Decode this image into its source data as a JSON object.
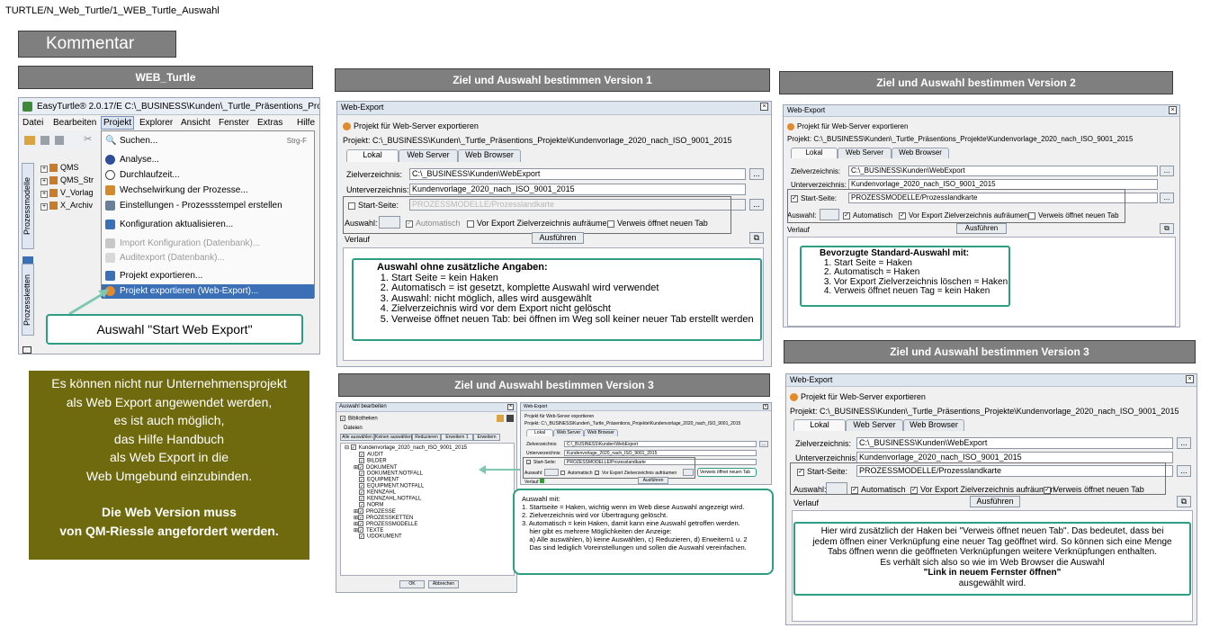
{
  "breadcrumb": "TURTLE/N_Web_Turtle/1_WEB_Turtle_Auswahl",
  "kommentar": "Kommentar",
  "headers": {
    "web_turtle": "WEB_Turtle",
    "v1": "Ziel und Auswahl  bestimmen Version 1",
    "v2": "Ziel und Auswahl  bestimmen Version 2",
    "v3a": "Ziel und Auswahl  bestimmen Version 3",
    "v3b": "Ziel und Auswahl  bestimmen Version 3"
  },
  "app": {
    "title": "EasyTurtle® 2.0.17/E C:\\_BUSINESS\\Kunden\\_Turtle_Präsentions_Projekte",
    "menubar": [
      "Datei",
      "Bearbeiten",
      "Projekt",
      "Explorer",
      "Ansicht",
      "Fenster",
      "Extras",
      "Hilfe"
    ],
    "tree": [
      "QMS",
      "QMS_Str",
      "V_Vorlag",
      "X_Archiv"
    ],
    "side_tabs": [
      "Prozessmodelle",
      "Prozessketten"
    ],
    "menu": [
      {
        "label": "Suchen...",
        "shortcut": "Strg-F"
      },
      {
        "label": "Analyse..."
      },
      {
        "label": "Durchlaufzeit..."
      },
      {
        "label": "Wechselwirkung der Prozesse..."
      },
      {
        "label": "Einstellungen - Prozessstempel erstellen"
      },
      {
        "label": "Konfiguration aktualisieren..."
      },
      {
        "label": "Import Konfiguration (Datenbank)..."
      },
      {
        "label": "Auditexport (Datenbank)..."
      },
      {
        "label": "Projekt exportieren..."
      },
      {
        "label": "Projekt exportieren (Web-Export)..."
      }
    ],
    "callout": "Auswahl \"Start Web Export\""
  },
  "comment": {
    "lines": [
      "Es können nicht nur Unternehmensprojekt",
      "als Web Export angewendet werden,",
      "es ist auch möglich,",
      "das Hilfe Handbuch",
      "als Web Export in die",
      "Web Umgebund einzubinden."
    ],
    "bold_lines": [
      "Die Web Version muss",
      "von QM-Riessle angefordert werden."
    ]
  },
  "webexport": {
    "window_title": "Web-Export",
    "heading": "Projekt für Web-Server exportieren",
    "project": "Projekt: C:\\_BUSINESS\\Kunden\\_Turtle_Präsentions_Projekte\\Kundenvorlage_2020_nach_ISO_9001_2015",
    "tabs": [
      "Lokal",
      "Web Server",
      "Web Browser"
    ],
    "zielverzeichnis_label": "Zielverzeichnis:",
    "zielverzeichnis": "C:\\_BUSINESS\\Kunden\\WebExport",
    "unterverzeichnis_label": "Unterverzeichnis:",
    "unterverzeichnis": "Kundenvorlage_2020_nach_ISO_9001_2015",
    "startseite_label": "Start-Seite:",
    "startseite": "PROZESSMODELLE/Prozesslandkarte",
    "auswahl_label": "Auswahl:",
    "automatisch": "Automatisch",
    "vor_export": "Vor Export Zielverzeichnis aufräumen",
    "verweis": "Verweis öffnet neuen Tab",
    "verlauf": "Verlauf",
    "ausfuehren": "Ausführen",
    "browse": "...",
    "verweis_box": "Verweis öffnet neuen Tab"
  },
  "v1_note": {
    "title": "Auswahl ohne zusätzliche Angaben:",
    "items": [
      "Start Seite = kein Haken",
      "Automatisch = ist gesetzt, komplette Auswahl wird verwendet",
      "Auswahl: nicht möglich, alles wird ausgewählt",
      "Zielverzeichnis wird vor dem Export nicht gelöscht",
      "Verweise öffnet neuen Tab: bei öffnen im Weg soll keiner neuer Tab erstellt werden"
    ]
  },
  "v2_note": {
    "title": "Bevorzugte Standard-Auswahl mit:",
    "items": [
      "Start Seite = Haken",
      "Automatisch = Haken",
      "Vor Export Zielverzeichnis löschen = Haken",
      "Verweis öffnet neuen Tag = kein Haken"
    ]
  },
  "v3a": {
    "dialog_title": "Auswahl bearbeiten",
    "bibliotheken": "Bibliotheken",
    "dateien": "Dateien",
    "buttons": [
      "Alle auswählen",
      "Keinen auswählen",
      "Reduzieren",
      "Erweitern 1",
      "Erweitern"
    ],
    "root": "Kundenvorlage_2020_nach_ISO_9001_2015",
    "items": [
      "AUDIT",
      "BILDER",
      "DOKUMENT",
      "DOKUMENT.NOTFALL",
      "EQUIPMENT",
      "EQUIPMENT.NOTFALL",
      "KENNZAHL",
      "KENNZAHL.NOTFALL",
      "NORM",
      "PROZESSE",
      "PROZESSKETTEN",
      "PROZESSMODELLE",
      "TEXTE",
      "UDOKUMENT"
    ],
    "ok": "OK",
    "abbrechen": "Abbrechen",
    "note_title": "Auswahl mit:",
    "note_lines": [
      "1. Startseite = Haken, wichtig wenn im Web diese Auswahl angezeigt wird.",
      "2. Zielverzeichnis wird vor Übertragung gelöscht.",
      "3. Automatisch = kein Haken, damit kann eine Auswahl getroffen werden.",
      "    hier gibt es mehrere Möglichkeiten der Anzeige:",
      "    a) Alle auswählen, b) keine Auswählen, c) Reduzieren, d) Erweitern1 u. 2",
      "    Das sind lediglich Voreinstellungen und sollen die Auswahl vereinfachen."
    ]
  },
  "v3b_note": {
    "lines": [
      "Hier wird zusätzlich der Haken bei \"Verweis öffnet neuen Tab\". Das bedeutet, dass bei",
      "jedem öffnen einer Verknüpfung eine neuer Tag geöffnet wird. So können sich eine Menge",
      "Tabs öffnen wenn die geöffneten Verknüpfungen weitere Verknüpfungen enthalten.",
      "Es verhält sich also so wie im Web Browser die Auswahl"
    ],
    "bold": "\"Link in neuem Fernster öffnen\"",
    "last": "ausgewählt wird."
  },
  "colors": {
    "olive": "#6f6a0e",
    "header_grey": "#7f7f7f",
    "teal": "#2e9e82",
    "menu_select": "#3b6fb6"
  }
}
